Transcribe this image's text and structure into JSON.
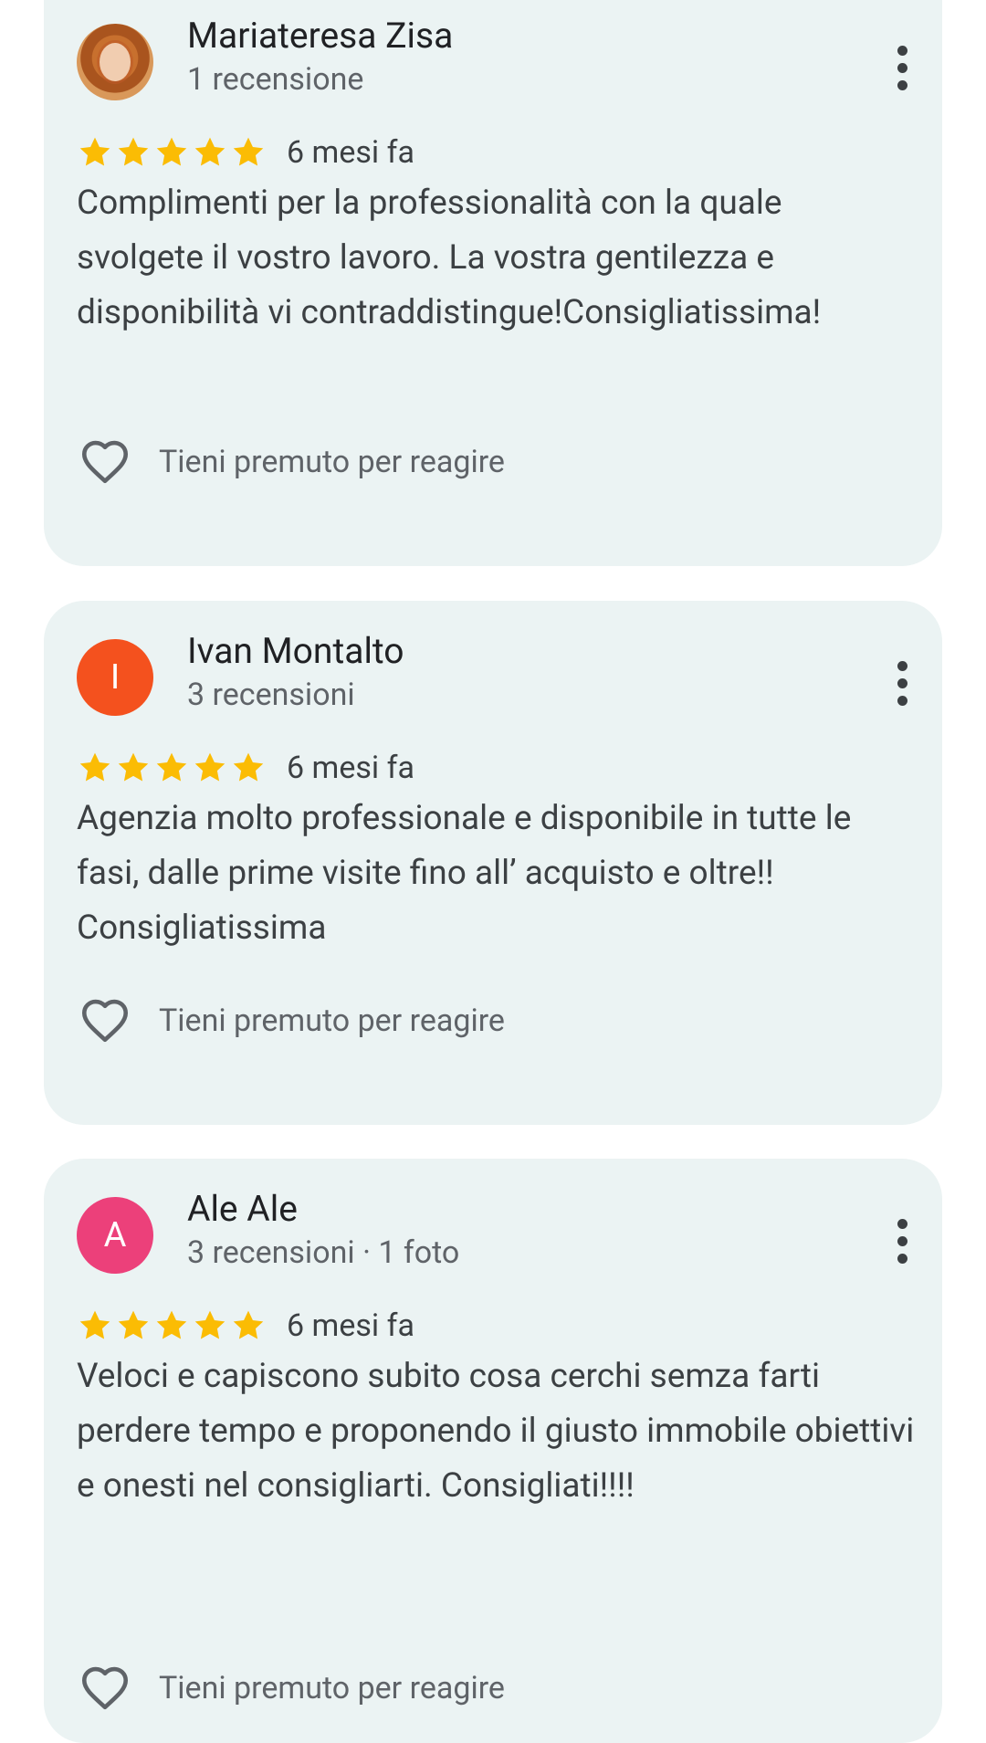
{
  "colors": {
    "card_background": "#ebf3f3",
    "star": "#fbbc04",
    "avatar_orange": "#f4511e",
    "avatar_pink": "#ec407a",
    "text_primary": "#202124",
    "text_secondary": "#5f6368"
  },
  "reviews": [
    {
      "author": "Mariateresa Zisa",
      "avatar_type": "photo",
      "meta": "1 recensione",
      "rating": 5,
      "date": "6 mesi fa",
      "text": "Complimenti per la professionalità con la quale svolgete il vostro lavoro. La vostra gentilezza e disponibilità vi contraddistingue!Consigliatissima!",
      "react_label": "Tieni premuto per reagire"
    },
    {
      "author": "Ivan Montalto",
      "avatar_type": "initial",
      "avatar_initial": "I",
      "avatar_color": "#f4511e",
      "meta": "3 recensioni",
      "rating": 5,
      "date": "6 mesi fa",
      "text": "Agenzia molto professionale e disponibile in tutte le fasi, dalle prime visite fino all’ acquisto e oltre!! Consigliatissima",
      "react_label": "Tieni premuto per reagire"
    },
    {
      "author": "Ale Ale",
      "avatar_type": "initial",
      "avatar_initial": "A",
      "avatar_color": "#ec407a",
      "meta": "3 recensioni · 1 foto",
      "rating": 5,
      "date": "6 mesi fa",
      "text": "Veloci e capiscono subito cosa cerchi semza farti perdere tempo e proponendo il giusto immobile obiettivi e onesti nel consigliarti. Consigliati!!!!",
      "react_label": "Tieni premuto per reagire"
    }
  ]
}
